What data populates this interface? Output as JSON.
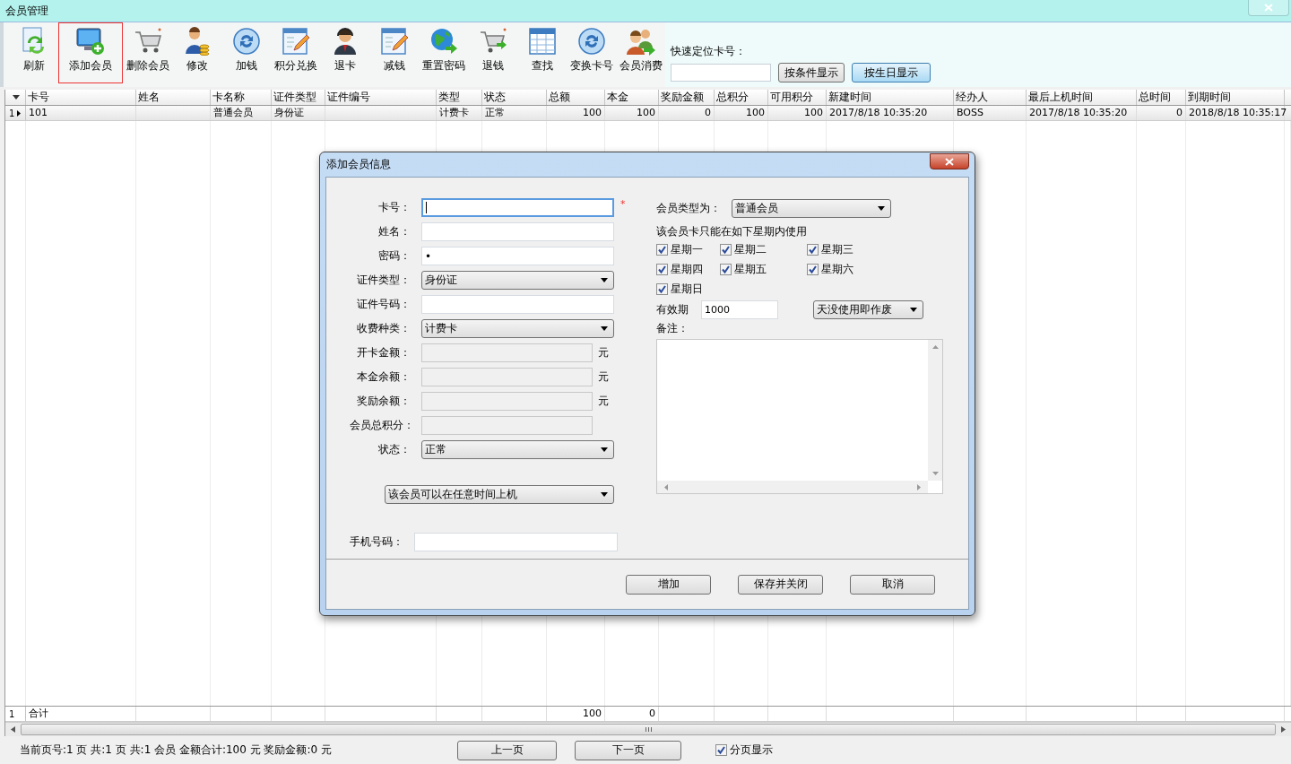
{
  "window": {
    "title": "会员管理"
  },
  "toolbar": {
    "items": [
      {
        "label": "刷新",
        "selected": false
      },
      {
        "label": "添加会员",
        "selected": true
      },
      {
        "label": "删除会员",
        "selected": false
      },
      {
        "label": "修改",
        "selected": false
      },
      {
        "label": "加钱",
        "selected": false
      },
      {
        "label": "积分兑换",
        "selected": false
      },
      {
        "label": "退卡",
        "selected": false
      },
      {
        "label": "减钱",
        "selected": false
      },
      {
        "label": "重置密码",
        "selected": false
      },
      {
        "label": "退钱",
        "selected": false
      },
      {
        "label": "查找",
        "selected": false
      },
      {
        "label": "变换卡号",
        "selected": false
      },
      {
        "label": "会员消费",
        "selected": false
      }
    ]
  },
  "quick_locate": {
    "label": "快速定位卡号：",
    "buttons": [
      {
        "label": "按条件显示",
        "selected": false
      },
      {
        "label": "按生日显示",
        "selected": true
      }
    ]
  },
  "table": {
    "columns": [
      {
        "label": "卡号",
        "kind": "text"
      },
      {
        "label": "姓名"
      },
      {
        "label": "卡名称",
        "kind": "text"
      },
      {
        "label": "证件类型",
        "kind": "text"
      },
      {
        "label": "证件编号"
      },
      {
        "label": "类型",
        "kind": "text"
      },
      {
        "label": "状态",
        "kind": "text"
      },
      {
        "label": "总额",
        "kind": "number"
      },
      {
        "label": "本金",
        "kind": "number"
      },
      {
        "label": "奖励金额",
        "kind": "number"
      },
      {
        "label": "总积分",
        "kind": "number"
      },
      {
        "label": "可用积分",
        "kind": "number"
      },
      {
        "label": "新建时间",
        "kind": "text"
      },
      {
        "label": "经办人",
        "kind": "text"
      },
      {
        "label": "最后上机时间",
        "kind": "text"
      },
      {
        "label": "总时间",
        "kind": "number"
      },
      {
        "label": "到期时间",
        "kind": "text"
      }
    ],
    "rows": [
      {
        "index": "1",
        "current": true,
        "cells": [
          "101",
          null,
          "普通会员",
          "身份证",
          null,
          "计费卡",
          "正常",
          "100",
          "100",
          "0",
          "100",
          "100",
          "2017/8/18 10:35:20",
          "BOSS",
          "2017/8/18 10:35:20",
          "0",
          "2018/8/18 10:35:17"
        ]
      }
    ],
    "total_row": {
      "index": "1",
      "cells": [
        "合计",
        null,
        null,
        null,
        null,
        null,
        null,
        "100",
        "0",
        null,
        null,
        null,
        null,
        null,
        null,
        null,
        null
      ]
    }
  },
  "footer": {
    "summary": "当前页号:1 页 共:1 页 共:1 会员 金额合计:100 元 奖励金额:0 元",
    "buttons": [
      "上一页",
      "下一页"
    ],
    "paging": {
      "label": "分页显示",
      "checked": true
    }
  },
  "dialog": {
    "title": "添加会员信息",
    "fields": [
      {
        "label": "卡号：",
        "kind": "text",
        "focused": true,
        "required_mark": "*"
      },
      {
        "label": "姓名：",
        "kind": "text",
        "focused": false
      },
      {
        "label": "密码：",
        "kind": "password",
        "value": "•",
        "focused": false
      },
      {
        "label": "证件类型：",
        "kind": "select",
        "value": "身份证"
      },
      {
        "label": "证件号码：",
        "kind": "text",
        "focused": false
      },
      {
        "label": "收费种类：",
        "kind": "select",
        "value": "计费卡"
      },
      {
        "label": "开卡金额：",
        "kind": "readonly",
        "unit": "元"
      },
      {
        "label": "本金余额：",
        "kind": "readonly",
        "unit": "元"
      },
      {
        "label": "奖励余额：",
        "kind": "readonly",
        "unit": "元"
      },
      {
        "label": "会员总积分：",
        "kind": "readonly"
      },
      {
        "label": "状态：",
        "kind": "select",
        "value": "正常"
      }
    ],
    "login_time_select": "该会员可以在任意时间上机",
    "phone": {
      "label": "手机号码："
    },
    "member_type": {
      "label": "会员类型为：",
      "value": "普通会员"
    },
    "weekday_note": "该会员卡只能在如下星期内使用",
    "weekdays": [
      {
        "label": "星期一",
        "checked": true
      },
      {
        "label": "星期二",
        "checked": true
      },
      {
        "label": "星期三",
        "checked": true
      },
      {
        "label": "星期四",
        "checked": true
      },
      {
        "label": "星期五",
        "checked": true
      },
      {
        "label": "星期六",
        "checked": true
      },
      {
        "label": "星期日",
        "checked": true
      }
    ],
    "validity": {
      "label": "有效期",
      "value": "1000",
      "mode": "天没使用即作废"
    },
    "notes": {
      "label": "备注："
    },
    "buttons": [
      "增加",
      "保存并关闭",
      "取消"
    ]
  }
}
